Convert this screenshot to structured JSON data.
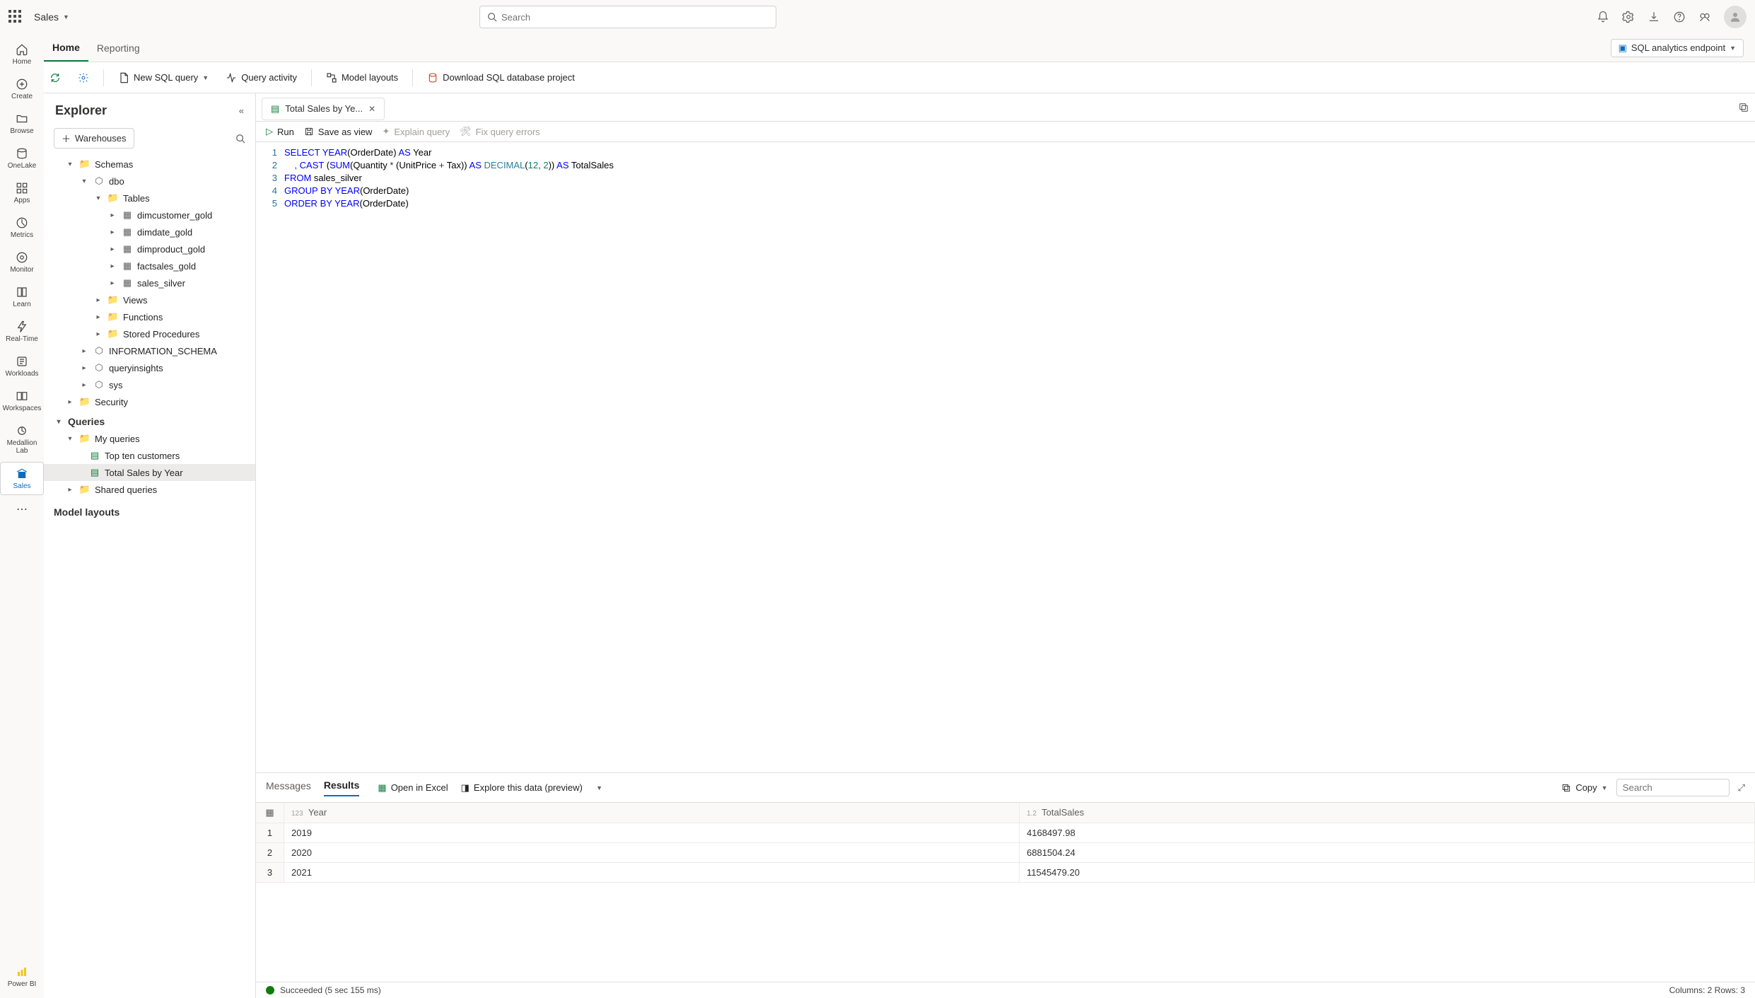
{
  "top": {
    "workspace": "Sales",
    "search_placeholder": "Search"
  },
  "tabs": {
    "home": "Home",
    "reporting": "Reporting"
  },
  "endpoint": {
    "label": "SQL analytics endpoint"
  },
  "toolbar": {
    "new_query": "New SQL query",
    "query_activity": "Query activity",
    "model_layouts": "Model layouts",
    "download_project": "Download SQL database project"
  },
  "rail": {
    "home": "Home",
    "create": "Create",
    "browse": "Browse",
    "onelake": "OneLake",
    "apps": "Apps",
    "metrics": "Metrics",
    "monitor": "Monitor",
    "learn": "Learn",
    "realtime": "Real-Time",
    "workloads": "Workloads",
    "workspaces": "Workspaces",
    "medallion": "Medallion Lab",
    "sales": "Sales",
    "powerbi": "Power BI"
  },
  "explorer": {
    "title": "Explorer",
    "warehouses_btn": "Warehouses",
    "schemas": "Schemas",
    "dbo": "dbo",
    "tables": "Tables",
    "table_list": [
      "dimcustomer_gold",
      "dimdate_gold",
      "dimproduct_gold",
      "factsales_gold",
      "sales_silver"
    ],
    "views": "Views",
    "functions": "Functions",
    "stored_procs": "Stored Procedures",
    "info_schema": "INFORMATION_SCHEMA",
    "queryinsights": "queryinsights",
    "sys": "sys",
    "security": "Security",
    "queries": "Queries",
    "my_queries": "My queries",
    "query_list": [
      "Top ten customers",
      "Total Sales by Year"
    ],
    "shared_queries": "Shared queries",
    "model_layouts": "Model layouts"
  },
  "file_tab": {
    "label": "Total Sales by Ye..."
  },
  "editor_toolbar": {
    "run": "Run",
    "save_view": "Save as view",
    "explain": "Explain query",
    "fix": "Fix query errors"
  },
  "code": {
    "lines": [
      "1",
      "2",
      "3",
      "4",
      "5"
    ]
  },
  "results": {
    "tabs": {
      "messages": "Messages",
      "results": "Results"
    },
    "open_excel": "Open in Excel",
    "explore": "Explore this data (preview)",
    "copy": "Copy",
    "search_placeholder": "Search",
    "columns": {
      "year": "Year",
      "total": "TotalSales"
    },
    "rows": [
      {
        "idx": "1",
        "year": "2019",
        "total": "4168497.98"
      },
      {
        "idx": "2",
        "year": "2020",
        "total": "6881504.24"
      },
      {
        "idx": "3",
        "year": "2021",
        "total": "11545479.20"
      }
    ]
  },
  "status": {
    "msg": "Succeeded (5 sec 155 ms)",
    "summary": "Columns: 2 Rows: 3"
  },
  "chart_data": {
    "type": "table",
    "title": "Total Sales by Year",
    "columns": [
      "Year",
      "TotalSales"
    ],
    "rows": [
      [
        2019,
        4168497.98
      ],
      [
        2020,
        6881504.24
      ],
      [
        2021,
        11545479.2
      ]
    ]
  }
}
